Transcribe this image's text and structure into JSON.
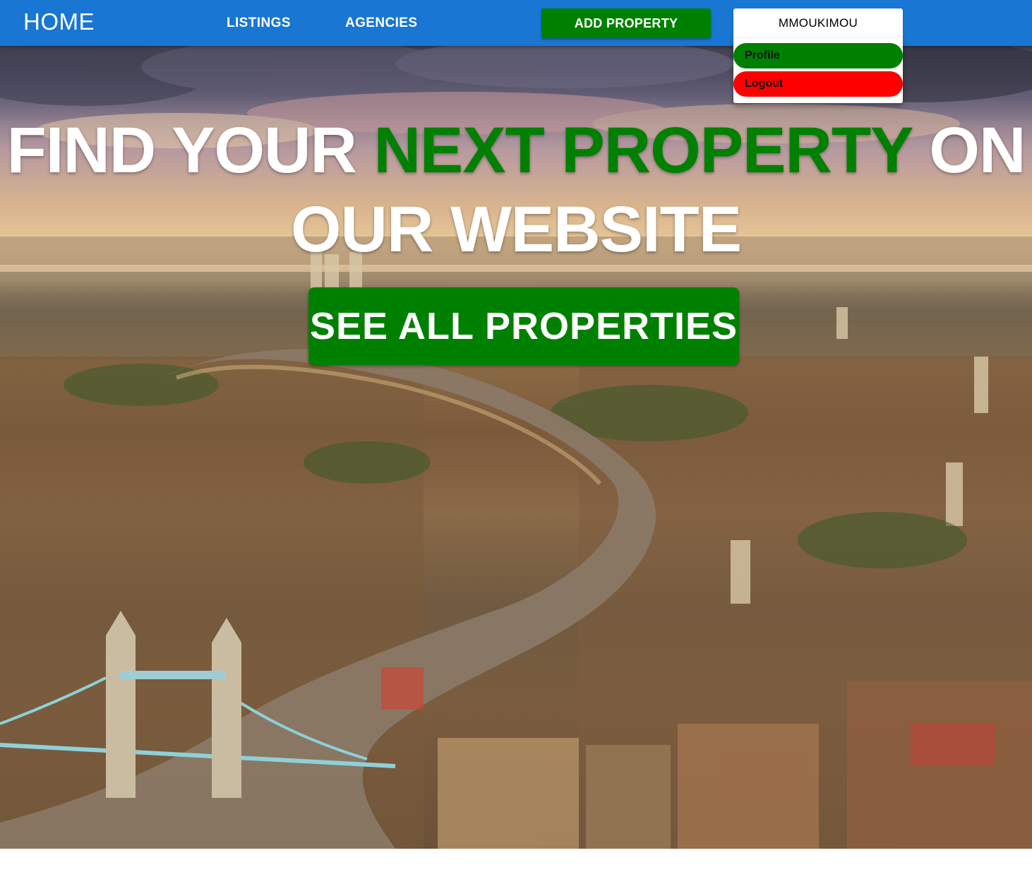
{
  "navbar": {
    "home_label": "HOME",
    "links": [
      {
        "label": "LISTINGS"
      },
      {
        "label": "AGENCIES"
      }
    ],
    "add_property_label": "ADD PROPERTY",
    "user_label": "MMOUKIMOU",
    "bg_color": "#1976d2"
  },
  "user_menu": {
    "items": [
      {
        "label": "Profile",
        "color": "#008000"
      },
      {
        "label": "Logout",
        "color": "#ff0000"
      }
    ]
  },
  "hero": {
    "title_part1": "FIND YOUR ",
    "title_highlight": "NEXT PROPERTY",
    "title_part2": " ON OUR WEBSITE",
    "cta_label": "SEE ALL PROPERTIES",
    "highlight_color": "#008000",
    "image_description_icon": "city-river-aerial-photo"
  }
}
